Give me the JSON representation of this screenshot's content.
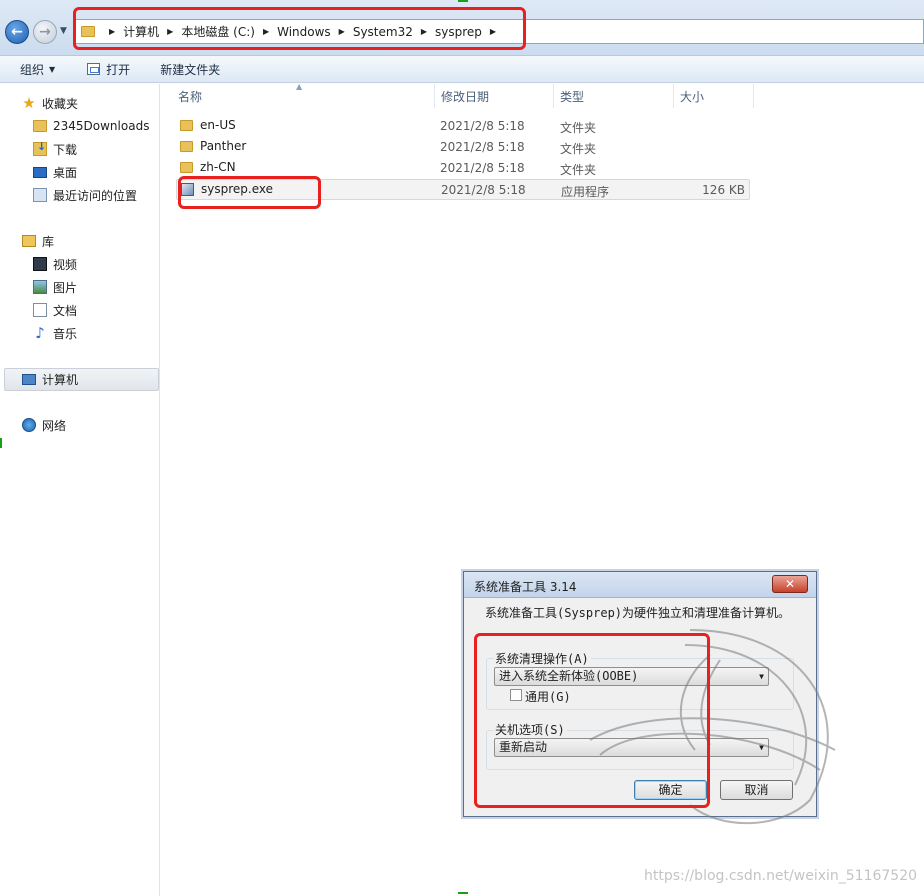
{
  "address": {
    "crumbs": [
      "计算机",
      "本地磁盘 (C:)",
      "Windows",
      "System32",
      "sysprep"
    ]
  },
  "toolbar": {
    "organize_label": "组织",
    "open_label": "打开",
    "new_folder_label": "新建文件夹"
  },
  "nav": {
    "favorites": "收藏夹",
    "fav_items": [
      "2345Downloads",
      "下载",
      "桌面",
      "最近访问的位置"
    ],
    "libraries": "库",
    "lib_items": [
      "视频",
      "图片",
      "文档",
      "音乐"
    ],
    "computer": "计算机",
    "network": "网络"
  },
  "columns": {
    "name": "名称",
    "date": "修改日期",
    "type": "类型",
    "size": "大小"
  },
  "files": [
    {
      "name": "en-US",
      "date": "2021/2/8 5:18",
      "type": "文件夹",
      "size": "",
      "icon": "folder-icon"
    },
    {
      "name": "Panther",
      "date": "2021/2/8 5:18",
      "type": "文件夹",
      "size": "",
      "icon": "folder-icon"
    },
    {
      "name": "zh-CN",
      "date": "2021/2/8 5:18",
      "type": "文件夹",
      "size": "",
      "icon": "folder-icon"
    },
    {
      "name": "sysprep.exe",
      "date": "2021/2/8 5:18",
      "type": "应用程序",
      "size": "126 KB",
      "icon": "exe-icon"
    }
  ],
  "dialog": {
    "title": "系统准备工具 3.14",
    "close_label": "✕",
    "description": "系统准备工具(Sysprep)为硬件独立和清理准备计算机。",
    "cleanup_group_label": "系统清理操作(A)",
    "cleanup_value": "进入系统全新体验(OOBE)",
    "generalize_label": "通用(G)",
    "generalize_checked": false,
    "shutdown_group_label": "关机选项(S)",
    "shutdown_value": "重新启动",
    "ok_label": "确定",
    "cancel_label": "取消"
  },
  "watermark": "https://blog.csdn.net/weixin_51167520",
  "colors": {
    "highlight_box": "#e8201e",
    "title_gradient": "#c3d4ea"
  }
}
